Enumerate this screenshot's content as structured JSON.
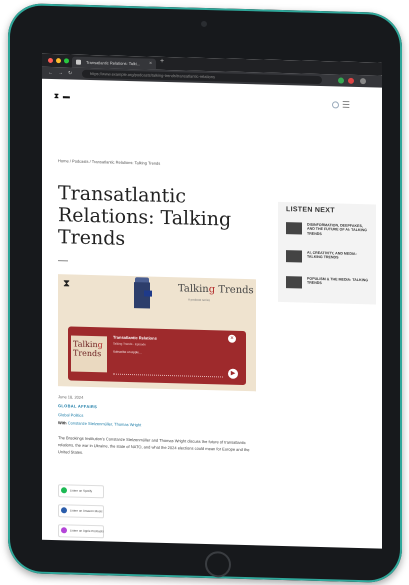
{
  "browser": {
    "tab_title": "Transatlantic Relations: Talki...",
    "tab_close": "×",
    "new_tab": "+",
    "address": "https://www.example.org/podcasts/talking-trends/transatlantic-relations"
  },
  "breadcrumb": {
    "home": "Home",
    "sep1": "/",
    "podcasts": "Podcasts",
    "sep2": "/",
    "current": "Transatlantic Relations: Talking Trends"
  },
  "article": {
    "title": "Transatlantic Relations: Talking Trends",
    "date": "June 18, 2024",
    "category": "GLOBAL AFFAIRS",
    "subcategory": "Global Politics",
    "with_prefix": "With",
    "with_names": "Constanze Stelzenmüller, Thomas Wright",
    "body": "The Brookings Institution's Constanze Stelzenmüller and Thomas Wright discuss the future of transatlantic relations, the war in Ukraine, the state of NATO, and what the 2024 elections could mean for Europe and the United States."
  },
  "hero": {
    "brand_main": "Talkin",
    "brand_accent": "g",
    "brand_end": " Trends",
    "tagline": "A podcast series",
    "art_text_1": "Talkin",
    "art_text_2": "g",
    "art_text_3": "Trends",
    "player_title": "Transatlantic Relations",
    "player_subtitle": "Talking Trends · Episode",
    "player_subscribe": "Subscribe on Apple…",
    "close_glyph": "×",
    "play_glyph": "▶"
  },
  "badges": [
    {
      "label": "Listen on Spotify",
      "color": "#1db954"
    },
    {
      "label": "Listen on Amazon Music",
      "color": "#2b5dab"
    },
    {
      "label": "Listen on Apple Podcasts",
      "color": "#b445d8"
    }
  ],
  "listen_next": {
    "heading": "LISTEN NEXT",
    "items": [
      {
        "text": "DISINFORMATION, DEEPFAKES, AND THE FUTURE OF AI: TALKING TRENDS"
      },
      {
        "text": "AI, CREATIVITY, AND MEDIA: TALKING TRENDS"
      },
      {
        "text": "POPULISM & THE MEDIA: TALKING TRENDS"
      }
    ]
  },
  "colors": {
    "accent_link": "#1f7ea8",
    "player_red": "#9e2a2c",
    "device_trim": "#2fa79a"
  }
}
